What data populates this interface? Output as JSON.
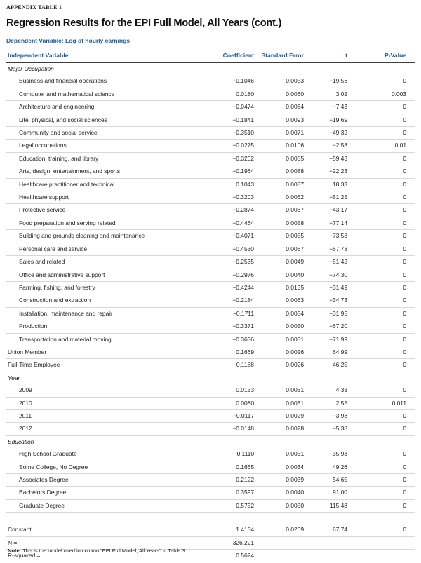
{
  "document": {
    "kicker": "APPENDIX TABLE 1",
    "title": "Regression Results for the EPI Full Model, All Years (cont.)",
    "dependent_variable": "Dependent Variable: Log of hourly earnings",
    "note_label": "Note:",
    "note_text": " This is the model used in column “EPI Full Model, All Years” in Table 3."
  },
  "colors": {
    "header_blue": "#1f5c9e",
    "rule_dark": "#3d3d3d",
    "rule_light": "#d8d8d8",
    "text": "#231f20"
  },
  "table": {
    "columns": [
      "Independent Variable",
      "Coefficient",
      "Standard Error",
      "t",
      "P-Value"
    ],
    "rows": [
      {
        "kind": "group",
        "label": "Major Occupation",
        "coefficient": "",
        "std_error": "",
        "t": "",
        "p_value": ""
      },
      {
        "kind": "indent",
        "label": "Business and financial operations",
        "coefficient": "−0.1046",
        "std_error": "0.0053",
        "t": "−19.56",
        "p_value": "0"
      },
      {
        "kind": "indent",
        "label": "Computer and mathematical science",
        "coefficient": "0.0180",
        "std_error": "0.0060",
        "t": "3.02",
        "p_value": "0.003"
      },
      {
        "kind": "indent",
        "label": "Architecture and engineering",
        "coefficient": "−0.0474",
        "std_error": "0.0064",
        "t": "−7.43",
        "p_value": "0"
      },
      {
        "kind": "indent",
        "label": "Life, physical, and social sciences",
        "coefficient": "−0.1841",
        "std_error": "0.0093",
        "t": "−19.69",
        "p_value": "0"
      },
      {
        "kind": "indent",
        "label": "Community and social service",
        "coefficient": "−0.3510",
        "std_error": "0.0071",
        "t": "−49.32",
        "p_value": "0"
      },
      {
        "kind": "indent",
        "label": "Legal occupations",
        "coefficient": "−0.0275",
        "std_error": "0.0106",
        "t": "−2.58",
        "p_value": "0.01"
      },
      {
        "kind": "indent",
        "label": "Education, training, and library",
        "coefficient": "−0.3262",
        "std_error": "0.0055",
        "t": "−59.43",
        "p_value": "0"
      },
      {
        "kind": "indent",
        "label": "Arts, design, entertainment, and sports",
        "coefficient": "−0.1964",
        "std_error": "0.0088",
        "t": "−22.23",
        "p_value": "0"
      },
      {
        "kind": "indent",
        "label": "Healthcare practitioner and technical",
        "coefficient": "0.1043",
        "std_error": "0.0057",
        "t": "18.33",
        "p_value": "0"
      },
      {
        "kind": "indent",
        "label": "Healthcare support",
        "coefficient": "−0.3203",
        "std_error": "0.0062",
        "t": "−51.25",
        "p_value": "0"
      },
      {
        "kind": "indent",
        "label": "Protective service",
        "coefficient": "−0.2874",
        "std_error": "0.0067",
        "t": "−43.17",
        "p_value": "0"
      },
      {
        "kind": "indent",
        "label": "Food preparation and serving related",
        "coefficient": "−0.4464",
        "std_error": "0.0058",
        "t": "−77.14",
        "p_value": "0"
      },
      {
        "kind": "indent",
        "label": "Building and grounds cleaning and maintenance",
        "coefficient": "−0.4071",
        "std_error": "0.0055",
        "t": "−73.58",
        "p_value": "0"
      },
      {
        "kind": "indent",
        "label": "Personal care and service",
        "coefficient": "−0.4530",
        "std_error": "0.0067",
        "t": "−67.73",
        "p_value": "0"
      },
      {
        "kind": "indent",
        "label": "Sales and related",
        "coefficient": "−0.2535",
        "std_error": "0.0049",
        "t": "−51.42",
        "p_value": "0"
      },
      {
        "kind": "indent",
        "label": "Office and administrative support",
        "coefficient": "−0.2976",
        "std_error": "0.0040",
        "t": "−74.30",
        "p_value": "0"
      },
      {
        "kind": "indent",
        "label": "Farming, fishing, and forestry",
        "coefficient": "−0.4244",
        "std_error": "0.0135",
        "t": "−31.49",
        "p_value": "0"
      },
      {
        "kind": "indent",
        "label": "Construction and extraction",
        "coefficient": "−0.2184",
        "std_error": "0.0063",
        "t": "−34.73",
        "p_value": "0"
      },
      {
        "kind": "indent",
        "label": "Installation, maintenance and repair",
        "coefficient": "−0.1711",
        "std_error": "0.0054",
        "t": "−31.95",
        "p_value": "0"
      },
      {
        "kind": "indent",
        "label": "Production",
        "coefficient": "−0.3371",
        "std_error": "0.0050",
        "t": "−67.20",
        "p_value": "0"
      },
      {
        "kind": "indent",
        "label": "Transportation and material moving",
        "coefficient": "−0.3656",
        "std_error": "0.0051",
        "t": "−71.99",
        "p_value": "0"
      },
      {
        "kind": "plain",
        "label": "Union Member",
        "coefficient": "0.1669",
        "std_error": "0.0026",
        "t": "64.99",
        "p_value": "0"
      },
      {
        "kind": "plain",
        "label": "Full-Time Employee",
        "coefficient": "0.1188",
        "std_error": "0.0026",
        "t": "46.25",
        "p_value": "0"
      },
      {
        "kind": "group",
        "label": "Year",
        "coefficient": "",
        "std_error": "",
        "t": "",
        "p_value": ""
      },
      {
        "kind": "indent",
        "label": "2009",
        "coefficient": "0.0133",
        "std_error": "0.0031",
        "t": "4.33",
        "p_value": "0"
      },
      {
        "kind": "indent",
        "label": "2010",
        "coefficient": "0.0080",
        "std_error": "0.0031",
        "t": "2.55",
        "p_value": "0.011"
      },
      {
        "kind": "indent",
        "label": "2011",
        "coefficient": "−0.0117",
        "std_error": "0.0029",
        "t": "−3.98",
        "p_value": "0"
      },
      {
        "kind": "indent",
        "label": "2012",
        "coefficient": "−0.0148",
        "std_error": "0.0028",
        "t": "−5.38",
        "p_value": "0"
      },
      {
        "kind": "group",
        "label": "Education",
        "coefficient": "",
        "std_error": "",
        "t": "",
        "p_value": ""
      },
      {
        "kind": "indent",
        "label": "High School Graduate",
        "coefficient": "0.1110",
        "std_error": "0.0031",
        "t": "35.93",
        "p_value": "0"
      },
      {
        "kind": "indent",
        "label": "Some College, No Degree",
        "coefficient": "0.1665",
        "std_error": "0.0034",
        "t": "49.26",
        "p_value": "0"
      },
      {
        "kind": "indent",
        "label": "Associates Degree",
        "coefficient": "0.2122",
        "std_error": "0.0039",
        "t": "54.65",
        "p_value": "0"
      },
      {
        "kind": "indent",
        "label": "Bachelors Degree",
        "coefficient": "0.3597",
        "std_error": "0.0040",
        "t": "91.00",
        "p_value": "0"
      },
      {
        "kind": "indent",
        "label": "Graduate Degree",
        "coefficient": "0.5732",
        "std_error": "0.0050",
        "t": "115.48",
        "p_value": "0"
      },
      {
        "kind": "spacer",
        "label": "",
        "coefficient": "",
        "std_error": "",
        "t": "",
        "p_value": ""
      },
      {
        "kind": "plain",
        "label": "Constant",
        "coefficient": "1.4154",
        "std_error": "0.0209",
        "t": "67.74",
        "p_value": "0"
      },
      {
        "kind": "plain",
        "label": "N =",
        "coefficient": "326,221",
        "std_error": "",
        "t": "",
        "p_value": ""
      },
      {
        "kind": "plain",
        "label": "R-squared =",
        "coefficient": "0.5624",
        "std_error": "",
        "t": "",
        "p_value": ""
      }
    ]
  }
}
